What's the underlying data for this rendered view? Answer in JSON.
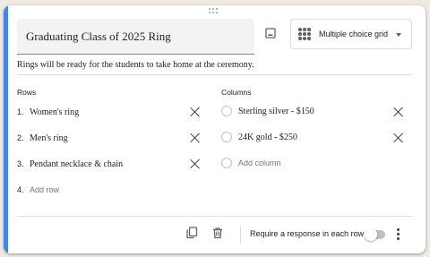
{
  "question": {
    "title": "Graduating Class of 2025 Ring",
    "type_label": "Multiple choice grid",
    "description": "Rings will be ready for the students to take home at the ceremony."
  },
  "rows": {
    "heading": "Rows",
    "items": [
      {
        "number": "1.",
        "label": "Women's ring"
      },
      {
        "number": "2.",
        "label": "Men's ring"
      },
      {
        "number": "3.",
        "label": "Pendant necklace & chain"
      }
    ],
    "add_number": "4.",
    "add_label": "Add row"
  },
  "columns": {
    "heading": "Columns",
    "items": [
      {
        "label": "Sterling silver - $150"
      },
      {
        "label": "24K gold - $250"
      }
    ],
    "add_label": "Add column"
  },
  "footer": {
    "required_label": "Require a response in each row",
    "required_on": false
  },
  "colors": {
    "accent": "#4285f4",
    "background": "#efebe3"
  },
  "icons": [
    "drag-handle-icon",
    "image-icon",
    "grid-icon",
    "chevron-down-icon",
    "close-icon",
    "radio-icon",
    "duplicate-icon",
    "delete-icon",
    "more-vert-icon"
  ]
}
